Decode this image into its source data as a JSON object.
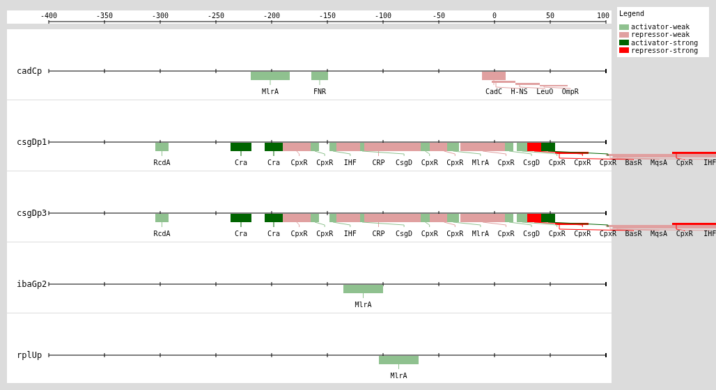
{
  "axis": {
    "ticks": [
      "-400",
      "-350",
      "-300",
      "-250",
      "-200",
      "-150",
      "-100",
      "-50",
      "0",
      "50",
      "100"
    ]
  },
  "legend": {
    "title": "Legend",
    "items": [
      {
        "label": "activator-weak",
        "kind": "activator-weak"
      },
      {
        "label": "repressor-weak",
        "kind": "repressor-weak"
      },
      {
        "label": "activator-strong",
        "kind": "activator-strong"
      },
      {
        "label": "repressor-strong",
        "kind": "repressor-strong"
      }
    ]
  },
  "tracks": [
    {
      "name": "cadCp",
      "sites": [
        {
          "label": "MlrA",
          "kind": "activator-weak"
        },
        {
          "label": "FNR",
          "kind": "activator-weak"
        },
        {
          "label": "CadC",
          "kind": "repressor-weak"
        },
        {
          "label": "H-NS",
          "kind": "repressor-weak"
        },
        {
          "label": "LeuO",
          "kind": "repressor-weak"
        },
        {
          "label": "OmpR",
          "kind": "repressor-weak"
        }
      ]
    },
    {
      "name": "csgDp1",
      "sites": [
        {
          "label": "RcdA",
          "kind": "activator-weak"
        },
        {
          "label": "Cra",
          "kind": "activator-strong"
        },
        {
          "label": "Cra",
          "kind": "activator-strong"
        },
        {
          "label": "CpxR",
          "kind": "repressor-weak"
        },
        {
          "label": "CpxR",
          "kind": "activator-weak"
        },
        {
          "label": "IHF",
          "kind": "activator-weak"
        },
        {
          "label": "CRP",
          "kind": "repressor-weak"
        },
        {
          "label": "CsgD",
          "kind": "activator-weak"
        },
        {
          "label": "CpxR",
          "kind": "activator-weak"
        },
        {
          "label": "CpxR",
          "kind": "repressor-weak"
        },
        {
          "label": "MlrA",
          "kind": "activator-weak"
        },
        {
          "label": "CpxR",
          "kind": "repressor-weak"
        },
        {
          "label": "CsgD",
          "kind": "activator-weak"
        },
        {
          "label": "CpxR",
          "kind": "activator-weak"
        },
        {
          "label": "CpxR",
          "kind": "repressor-strong"
        },
        {
          "label": "CpxR",
          "kind": "activator-strong"
        },
        {
          "label": "BasR",
          "kind": "repressor-strong"
        },
        {
          "label": "MqsA",
          "kind": "repressor-weak"
        },
        {
          "label": "CpxR",
          "kind": "repressor-strong"
        },
        {
          "label": "IHF",
          "kind": "repressor-weak"
        }
      ]
    },
    {
      "name": "csgDp3",
      "sites": [
        {
          "label": "RcdA",
          "kind": "activator-weak"
        },
        {
          "label": "Cra",
          "kind": "activator-strong"
        },
        {
          "label": "Cra",
          "kind": "activator-strong"
        },
        {
          "label": "CpxR",
          "kind": "repressor-weak"
        },
        {
          "label": "CpxR",
          "kind": "activator-weak"
        },
        {
          "label": "IHF",
          "kind": "activator-weak"
        },
        {
          "label": "CRP",
          "kind": "repressor-weak"
        },
        {
          "label": "CsgD",
          "kind": "activator-weak"
        },
        {
          "label": "CpxR",
          "kind": "activator-weak"
        },
        {
          "label": "CpxR",
          "kind": "repressor-weak"
        },
        {
          "label": "MlrA",
          "kind": "activator-weak"
        },
        {
          "label": "CpxR",
          "kind": "repressor-weak"
        },
        {
          "label": "CsgD",
          "kind": "activator-weak"
        },
        {
          "label": "CpxR",
          "kind": "activator-weak"
        },
        {
          "label": "CpxR",
          "kind": "repressor-strong"
        },
        {
          "label": "CpxR",
          "kind": "activator-strong"
        },
        {
          "label": "BasR",
          "kind": "repressor-strong"
        },
        {
          "label": "MqsA",
          "kind": "repressor-weak"
        },
        {
          "label": "CpxR",
          "kind": "repressor-strong"
        },
        {
          "label": "IHF",
          "kind": "repressor-weak"
        }
      ]
    },
    {
      "name": "ibaGp2",
      "sites": [
        {
          "label": "MlrA",
          "kind": "activator-weak"
        }
      ]
    },
    {
      "name": "rplUp",
      "sites": [
        {
          "label": "MlrA",
          "kind": "activator-weak"
        }
      ]
    }
  ]
}
